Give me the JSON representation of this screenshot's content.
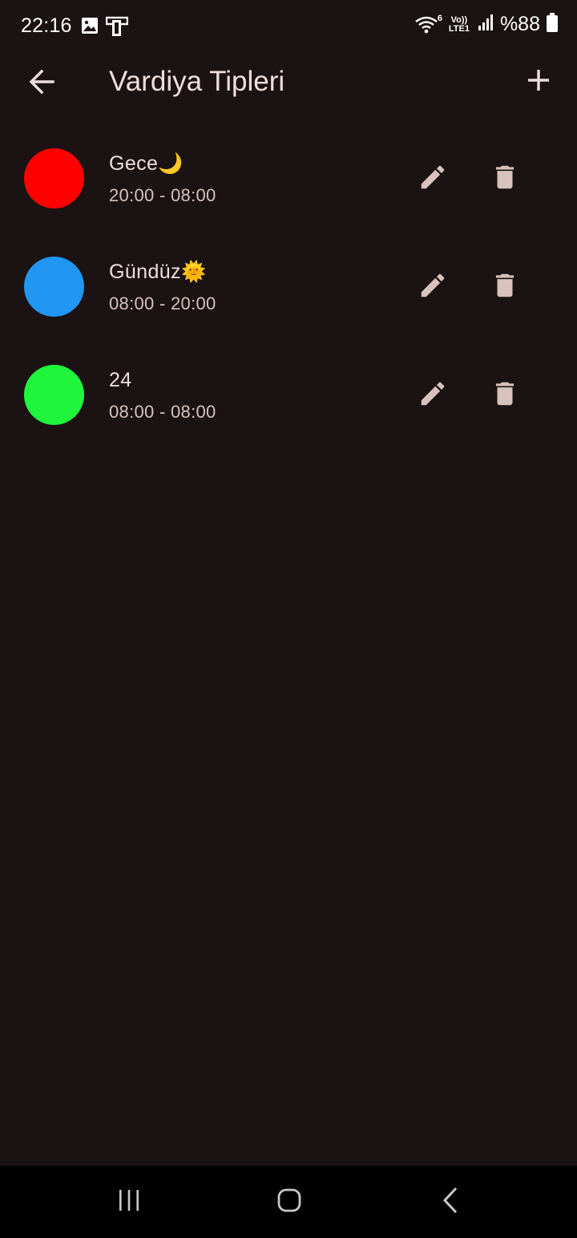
{
  "status_bar": {
    "time": "22:16",
    "battery": "%88",
    "network_label": "LTE1",
    "volte_label": "Vo))",
    "wifi_sub": "6",
    "icons": [
      "gallery-icon",
      "screen-cast-icon",
      "wifi-icon",
      "volte-icon",
      "signal-icon",
      "battery-icon"
    ]
  },
  "app_bar": {
    "title": "Vardiya Tipleri",
    "back_icon": "arrow-back-icon",
    "add_icon": "plus-icon"
  },
  "shifts": [
    {
      "name": "Gece🌙",
      "time": "20:00 - 08:00",
      "color": "#ff0000"
    },
    {
      "name": "Gündüz🌞",
      "time": "08:00 - 20:00",
      "color": "#2196f3"
    },
    {
      "name": "24",
      "time": "08:00 - 08:00",
      "color": "#1ff53b"
    }
  ],
  "colors": {
    "background": "#1b1313",
    "text": "#efdfdc",
    "subtext": "#d7c2be",
    "icon": "#d9c2bd"
  },
  "nav_bar": {
    "icons": [
      "recent-apps-icon",
      "home-icon",
      "nav-back-icon"
    ]
  }
}
